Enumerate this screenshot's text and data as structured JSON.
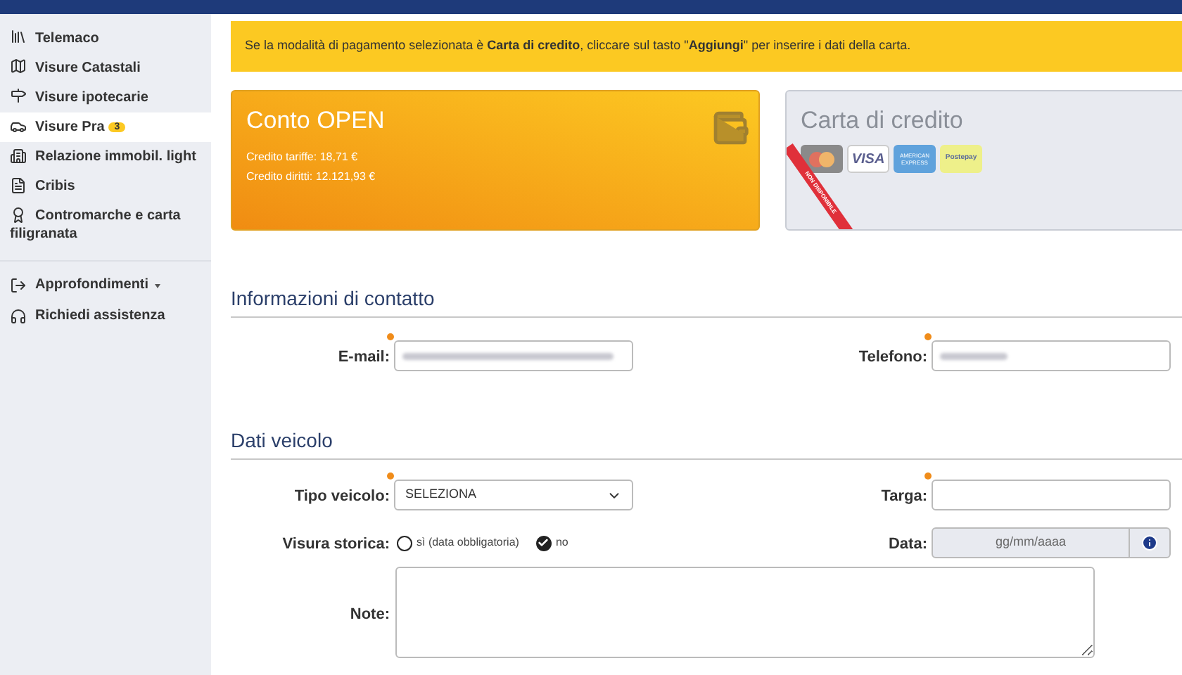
{
  "sidebar": {
    "items": [
      {
        "label": "Telemaco",
        "selected": false
      },
      {
        "label": "Visure Catastali",
        "selected": false
      },
      {
        "label": "Visure ipotecarie",
        "selected": false
      },
      {
        "label": "Visure Pra",
        "selected": true,
        "badge": "3"
      },
      {
        "label": "Relazione immobil. light",
        "selected": false
      },
      {
        "label": "Cribis",
        "selected": false
      },
      {
        "label": "Contromarche e carta filigranata",
        "selected": false
      }
    ],
    "extra_items": [
      {
        "label": "Approfondimenti",
        "dropdown": true
      },
      {
        "label": "Richiedi assistenza",
        "dropdown": false
      }
    ]
  },
  "notice": "Se la modalità di pagamento selezionata è **Carta di credito**, cliccare sul tasto \"**Aggiungi**\" per inserire i dati della carta.",
  "payment_cards": [
    {
      "kind": "account",
      "title": "Conto OPEN",
      "lines": [
        "Credito tariffe: 18,71 €",
        "Credito diritti: 12.121,93 €"
      ],
      "selected": true
    },
    {
      "kind": "credit_card",
      "title": "Carta di credito",
      "ribbon": "NON DISPONIBILE",
      "logos": [
        {
          "kind": "mastercard"
        },
        {
          "kind": "visa",
          "label": "VISA"
        },
        {
          "kind": "amex",
          "label": "AMERICAN EXPRESS"
        },
        {
          "kind": "postepay",
          "label": "Postepay"
        }
      ],
      "selected": false
    }
  ],
  "contact": {
    "title": "Informazioni di contatto",
    "fields": [
      {
        "label": "E-mail:",
        "required": true,
        "blurred": true
      },
      {
        "label": "Telefono:",
        "required": true,
        "blurred": true
      }
    ]
  },
  "vehicle": {
    "title": "Dati veicolo",
    "tipo": {
      "label": "Tipo veicolo:",
      "value": "SELEZIONA",
      "required": true
    },
    "targa": {
      "label": "Targa:",
      "required": true
    },
    "storica": {
      "label": "Visura storica:",
      "options": [
        {
          "label": "sì (data obbligatoria)",
          "selected": false
        },
        {
          "label": "no",
          "selected": true
        }
      ]
    },
    "data": {
      "label": "Data:",
      "placeholder": "gg/mm/aaaa",
      "disabled": true
    },
    "note": {
      "label": "Note:"
    }
  }
}
